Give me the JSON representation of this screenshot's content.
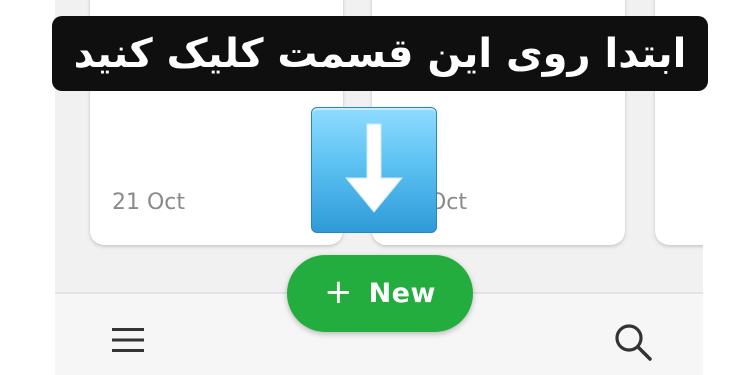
{
  "banner": {
    "text": "ابتدا روی این قسمت کلیک کنید"
  },
  "notes": [
    {
      "date": "21 Oct"
    },
    {
      "date": "21 Oct"
    }
  ],
  "fab": {
    "icon": "plus-icon",
    "label": "New"
  },
  "toolbar": {
    "menu_icon": "hamburger-menu-icon",
    "search_icon": "search-icon"
  },
  "overlay": {
    "icon": "arrow-down-icon"
  },
  "colors": {
    "accent": "#22ad3e",
    "banner_bg": "#0f0f0f",
    "arrow_tile": "#5cc2f2"
  }
}
